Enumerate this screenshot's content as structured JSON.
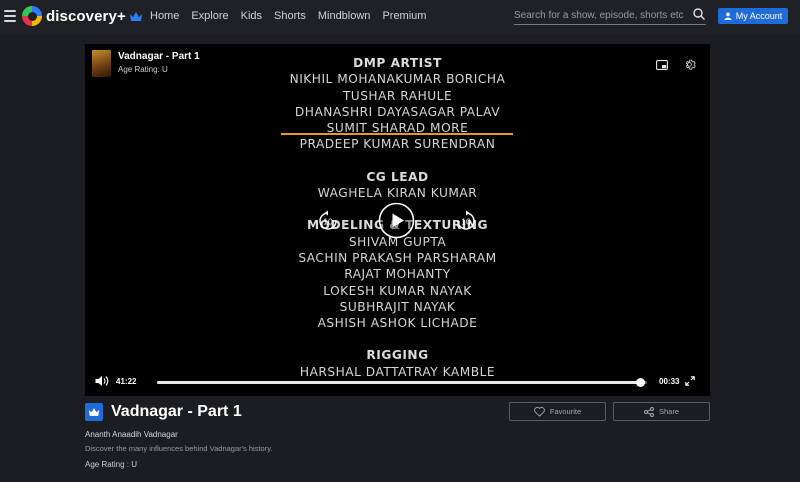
{
  "header": {
    "brand": "discovery+",
    "nav": [
      "Home",
      "Explore",
      "Kids",
      "Shorts",
      "Mindblown",
      "Premium"
    ],
    "search_placeholder": "Search for a show, episode, shorts etc.",
    "account_label": "My Account",
    "icons": [
      "menu-icon",
      "crown-icon",
      "search-icon",
      "user-icon"
    ]
  },
  "player": {
    "episode_title": "Vadnagar - Part 1",
    "age_rating": "Age Rating: U",
    "credits": [
      {
        "text": "DMP ARTIST",
        "head": true
      },
      {
        "text": "NIKHIL MOHANAKUMAR BORICHA"
      },
      {
        "text": "TUSHAR RAHULE"
      },
      {
        "text": "DHANASHRI DAYASAGAR PALAV"
      },
      {
        "text": "SUMIT SHARAD MORE"
      },
      {
        "text": "PRADEEP KUMAR SURENDRAN"
      },
      {
        "gap": true
      },
      {
        "text": "CG LEAD",
        "head": true
      },
      {
        "text": "WAGHELA KIRAN KUMAR"
      },
      {
        "gap": true
      },
      {
        "text": "MODELING & TEXTURING",
        "head": true
      },
      {
        "text": "SHIVAM GUPTA"
      },
      {
        "text": "SACHIN PRAKASH PARSHARAM"
      },
      {
        "text": "RAJAT MOHANTY"
      },
      {
        "text": "LOKESH KUMAR NAYAK"
      },
      {
        "text": "SUBHRAJIT NAYAK"
      },
      {
        "text": "ASHISH ASHOK LICHADE"
      },
      {
        "gap": true
      },
      {
        "text": "RIGGING",
        "head": true
      },
      {
        "text": "HARSHAL DATTATRAY KAMBLE"
      }
    ],
    "rewind_seconds": "10",
    "forward_seconds": "10",
    "time_elapsed": "41:22",
    "time_remaining": "00:33",
    "progress_fraction": 0.9868,
    "accent_color": "#e39a2d"
  },
  "info": {
    "title": "Vadnagar - Part 1",
    "subtitle": "Ananth Anaadih Vadnagar",
    "description": "Discover the many influences behind Vadnagar's history.",
    "age_rating": "Age Rating : U",
    "favourite_label": "Favourite",
    "share_label": "Share",
    "brand_color": "#1f6bd8"
  }
}
